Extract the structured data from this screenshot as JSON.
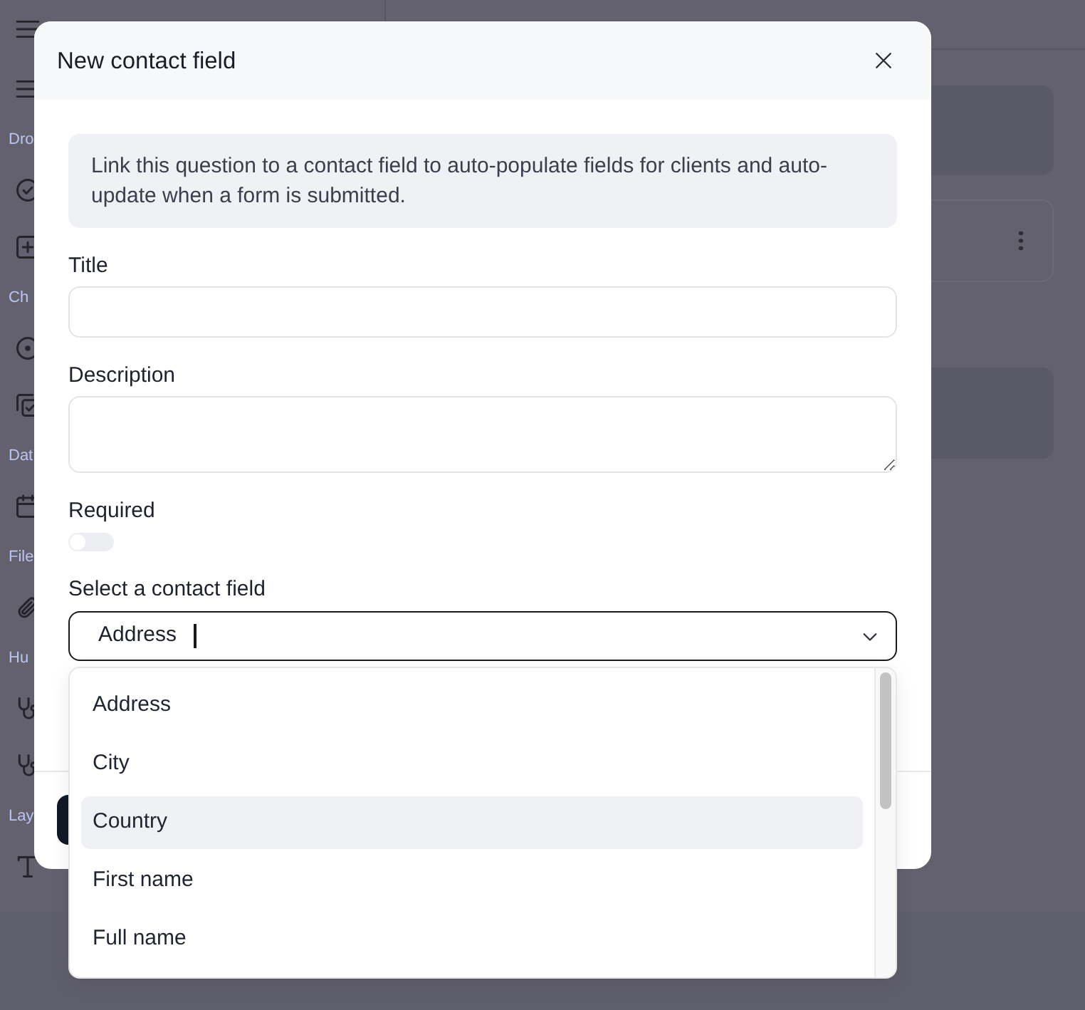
{
  "sidebar": {
    "sections": [
      {
        "label": "Dro"
      },
      {
        "label": "Ch"
      },
      {
        "label": "Dat"
      },
      {
        "label": "File"
      },
      {
        "label": "Hu"
      },
      {
        "label": "Lay"
      }
    ]
  },
  "dialog": {
    "title": "New contact field",
    "notice": "Link this question to a contact field to auto-populate fields for clients and auto-update when a form is submitted.",
    "fields": [
      {
        "kind": "text",
        "label": "Title"
      },
      {
        "kind": "textarea",
        "label": "Description"
      },
      {
        "kind": "toggle",
        "label": "Required",
        "on": false
      },
      {
        "kind": "select",
        "label": "Select a contact field",
        "value": "Address",
        "focused": true,
        "expanded": true,
        "options": [
          {
            "label": "Address",
            "highlighted": false
          },
          {
            "label": "City",
            "highlighted": false
          },
          {
            "label": "Country",
            "highlighted": true
          },
          {
            "label": "First name",
            "highlighted": false
          },
          {
            "label": "Full name",
            "highlighted": false
          }
        ]
      }
    ]
  }
}
